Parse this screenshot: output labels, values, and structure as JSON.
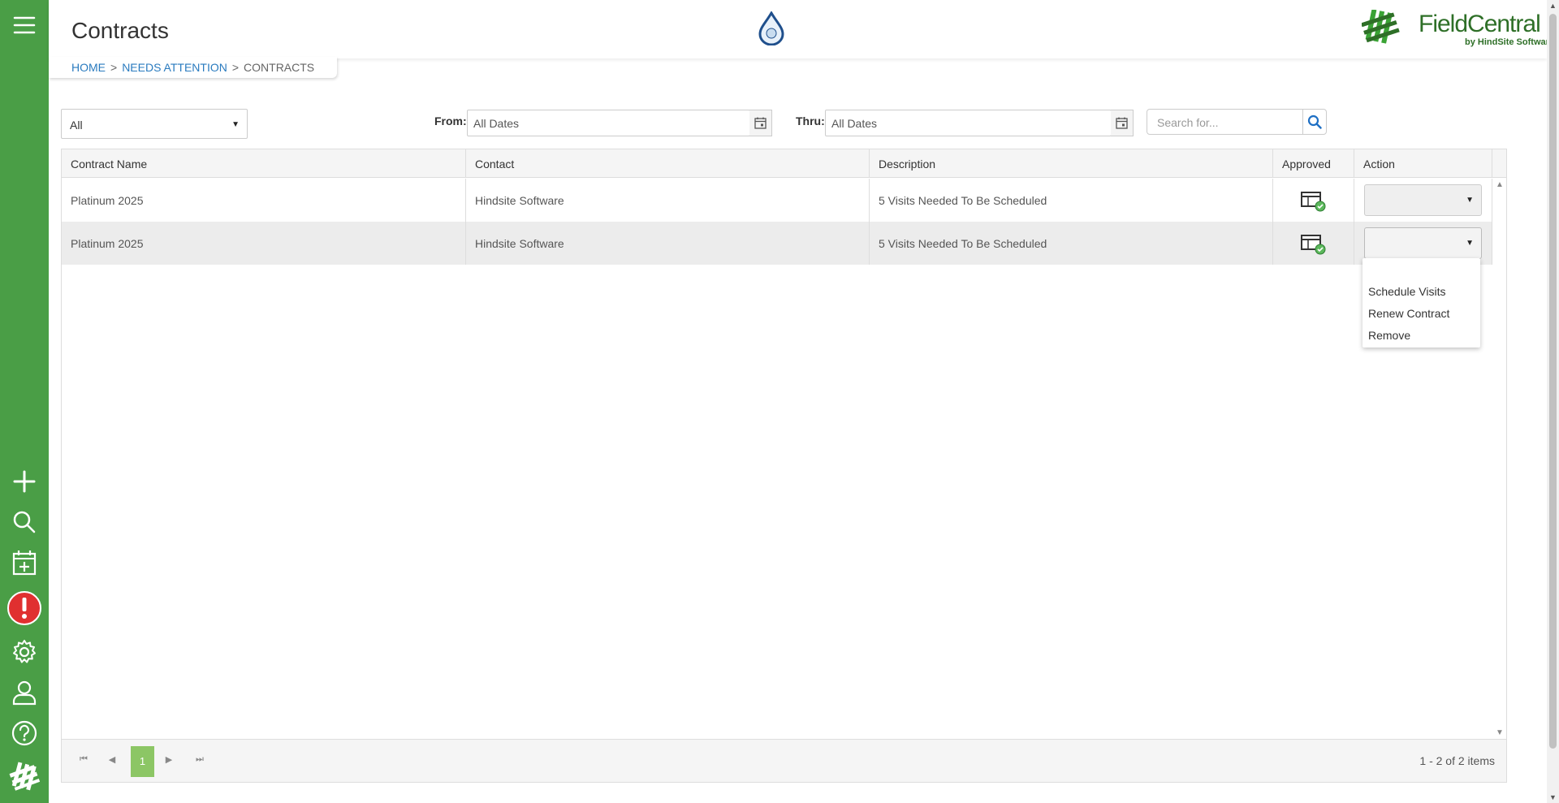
{
  "app": {
    "page_title": "Contracts",
    "brand_name": "FieldCentral",
    "brand_sub": "by HindSite Software"
  },
  "sidebar": {
    "items": [
      {
        "icon": "menu-icon"
      },
      {
        "icon": "add-icon"
      },
      {
        "icon": "search-icon"
      },
      {
        "icon": "calendar-add-icon"
      },
      {
        "icon": "alert-icon"
      },
      {
        "icon": "gear-icon"
      },
      {
        "icon": "user-icon"
      },
      {
        "icon": "help-icon"
      },
      {
        "icon": "logo-icon"
      }
    ]
  },
  "breadcrumb": {
    "home": "HOME",
    "sep1": ">",
    "needs_attention": "NEEDS ATTENTION",
    "sep2": ">",
    "current": "CONTRACTS"
  },
  "filters": {
    "status_value": "All",
    "from_label": "From:",
    "from_value": "All Dates",
    "thru_label": "Thru:",
    "thru_value": "All Dates",
    "search_placeholder": "Search for..."
  },
  "grid": {
    "columns": [
      "Contract Name",
      "Contact",
      "Description",
      "Approved",
      "Action"
    ],
    "rows": [
      {
        "contract_name": "Platinum 2025",
        "contact": "Hindsite Software",
        "description": "5 Visits Needed To Be Scheduled"
      },
      {
        "contract_name": "Platinum 2025",
        "contact": "Hindsite Software",
        "description": "5 Visits Needed To Be Scheduled"
      }
    ]
  },
  "action_menu": {
    "options": [
      "Schedule Visits",
      "Renew Contract",
      "Remove"
    ]
  },
  "pager": {
    "current_page": "1",
    "info": "1 - 2 of 2 items"
  },
  "colors": {
    "sidebar": "#4a9e46",
    "link": "#2a7bbf",
    "pager_active": "#8cc665",
    "alert": "#e03030"
  }
}
